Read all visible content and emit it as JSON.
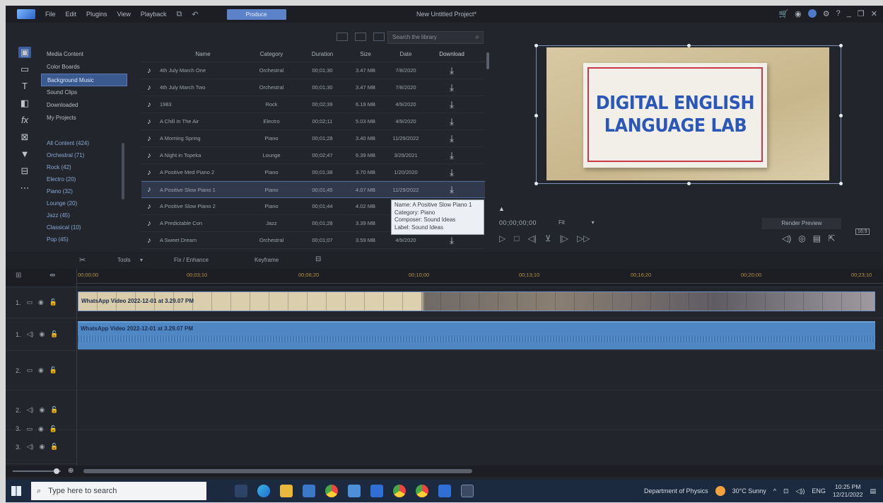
{
  "menubar": {
    "items": [
      "File",
      "Edit",
      "Plugins",
      "View",
      "Playback"
    ],
    "produce_label": "Produce",
    "project_title": "New Untitled Project*"
  },
  "library": {
    "search_placeholder": "Search the library",
    "categories": [
      "Media Content",
      "Color Boards",
      "Background Music",
      "Sound Clips",
      "Downloaded",
      "My Projects"
    ],
    "selected_category": "Background Music",
    "subcategories": [
      "All Content (424)",
      "Orchestral (71)",
      "Rock (42)",
      "Electro (20)",
      "Piano (32)",
      "Lounge (20)",
      "Jazz (45)",
      "Classical (10)",
      "Pop (45)"
    ],
    "columns": [
      "Name",
      "Category",
      "Duration",
      "Size",
      "Date",
      "Download"
    ],
    "rows": [
      {
        "name": "4th July March One",
        "category": "Orchestral",
        "duration": "00;01;30",
        "size": "3.47 MB",
        "date": "7/8/2020"
      },
      {
        "name": "4th July March Two",
        "category": "Orchestral",
        "duration": "00;01;30",
        "size": "3.47 MB",
        "date": "7/8/2020"
      },
      {
        "name": "1983",
        "category": "Rock",
        "duration": "00;02;39",
        "size": "6.19 MB",
        "date": "4/9/2020"
      },
      {
        "name": "A Chill In The Air",
        "category": "Electro",
        "duration": "00;02;11",
        "size": "5.03 MB",
        "date": "4/9/2020"
      },
      {
        "name": "A Morning Spring",
        "category": "Piano",
        "duration": "00;01;28",
        "size": "3.40 MB",
        "date": "11/29/2022"
      },
      {
        "name": "A Night in Topeka",
        "category": "Lounge",
        "duration": "00;02;47",
        "size": "6.39 MB",
        "date": "3/29/2021"
      },
      {
        "name": "A Positive Med Piano 2",
        "category": "Piano",
        "duration": "00;01;38",
        "size": "3.70 MB",
        "date": "1/20/2020"
      },
      {
        "name": "A Positive Slow Piano 1",
        "category": "Piano",
        "duration": "00;01;45",
        "size": "4.07 MB",
        "date": "11/29/2022"
      },
      {
        "name": "A Positive Slow Piano 2",
        "category": "Piano",
        "duration": "00;01;44",
        "size": "4.02 MB",
        "date": ""
      },
      {
        "name": "A Predictable Con",
        "category": "Jazz",
        "duration": "00;01;28",
        "size": "3.39 MB",
        "date": ""
      },
      {
        "name": "A Sweet Dream",
        "category": "Orchestral",
        "duration": "00;01;07",
        "size": "3.59 MB",
        "date": "4/9/2020"
      }
    ],
    "highlight_row": 7,
    "download_glyph": "⤓",
    "tooltip": {
      "name": "Name: A Positive Slow Piano 1",
      "category": "Category: Piano",
      "composer": "Composer: Sound Ideas",
      "label": "Label: Sound Ideas"
    }
  },
  "preview": {
    "card_line1": "DIGITAL ENGLISH",
    "card_line2": "LANGUAGE LAB",
    "timecode": "00;00;00;00",
    "fit_label": "Fit",
    "render_preview": "Render Preview",
    "aspect_ratio": "16:9"
  },
  "timeline": {
    "tools": [
      "Tools",
      "Fix / Enhance",
      "Keyframe"
    ],
    "ticks": [
      "00;00;00",
      "00;03;10",
      "00;06;20",
      "00;10;00",
      "00;13;10",
      "00;16;20",
      "00;20;00",
      "00;23;10"
    ],
    "tracks": [
      "1.",
      "1.",
      "2.",
      "2.",
      "3.",
      "3."
    ],
    "video_clip_title": "WhatsApp Video 2022-12-01 at 3.29.07 PM",
    "audio_clip_title": "WhatsApp Video 2022-12-01 at 3.29.07 PM"
  },
  "taskbar": {
    "search_placeholder": "Type here to search",
    "location": "Department of Physics",
    "weather": "30°C  Sunny",
    "language": "ENG",
    "time": "10:25 PM",
    "date": "12/21/2022"
  },
  "colors": {
    "accent": "#3a5a8f",
    "produce": "#5c83c9",
    "audio_clip": "#4f86c4",
    "card_text": "#2a57b8",
    "card_border": "#c83a4a"
  }
}
